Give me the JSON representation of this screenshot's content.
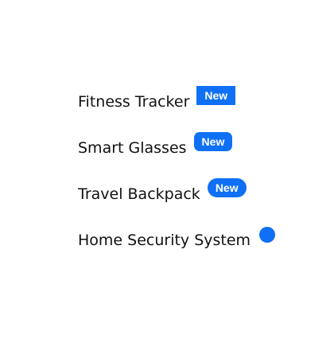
{
  "theme": {
    "accent": "#1070f5"
  },
  "items": [
    {
      "label": "Fitness Tracker",
      "badge": "New",
      "badge_style": "square"
    },
    {
      "label": "Smart Glasses",
      "badge": "New",
      "badge_style": "rounded"
    },
    {
      "label": "Travel Backpack",
      "badge": "New",
      "badge_style": "pill"
    },
    {
      "label": "Home Security System",
      "badge": "",
      "badge_style": "dot"
    }
  ]
}
